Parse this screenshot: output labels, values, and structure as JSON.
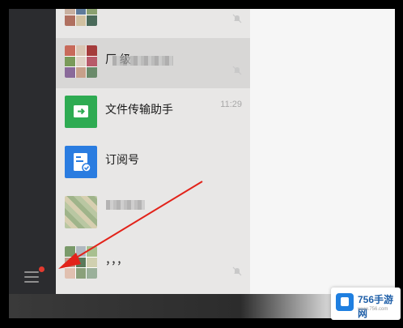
{
  "conversations": [
    {
      "name": "",
      "time": "",
      "muted": true,
      "avatar": "group-avatar"
    },
    {
      "name": "厂  级",
      "time": "",
      "muted": true,
      "avatar": "group-avatar"
    },
    {
      "name": "文件传输助手",
      "time": "11:29",
      "muted": false,
      "avatar": "file-transfer-icon"
    },
    {
      "name": "订阅号",
      "time": "",
      "muted": false,
      "avatar": "subscription-icon"
    },
    {
      "name": "",
      "time": "",
      "muted": false,
      "avatar": "blurred-avatar"
    },
    {
      "name": "，，，",
      "time": "",
      "muted": true,
      "avatar": "group-avatar"
    }
  ],
  "sidebar": {
    "menu_icon": "menu-icon",
    "badge_color": "#e33a2f"
  },
  "colors": {
    "accent_green": "#2eab52",
    "accent_blue": "#2a7ce0",
    "arrow_red": "#e2231a"
  },
  "watermark": {
    "brand": "756手游网",
    "url": "www.756.com"
  }
}
